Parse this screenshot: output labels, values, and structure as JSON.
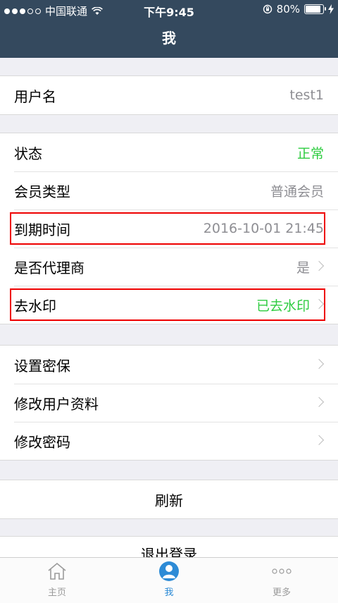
{
  "status_bar": {
    "carrier": "中国联通",
    "time": "下午9:45",
    "battery": "80%"
  },
  "nav": {
    "title": "我"
  },
  "account": {
    "username_label": "用户名",
    "username_value": "test1"
  },
  "info": {
    "status_label": "状态",
    "status_value": "正常",
    "member_type_label": "会员类型",
    "member_type_value": "普通会员",
    "expiry_label": "到期时间",
    "expiry_value": "2016-10-01 21:45",
    "agent_label": "是否代理商",
    "agent_value": "是",
    "watermark_label": "去水印",
    "watermark_value": "已去水印"
  },
  "settings": {
    "security_label": "设置密保",
    "edit_profile_label": "修改用户资料",
    "change_password_label": "修改密码"
  },
  "actions": {
    "refresh_label": "刷新",
    "logout_label": "退出登录"
  },
  "tabbar": {
    "home_label": "主页",
    "me_label": "我",
    "more_label": "更多"
  },
  "colors": {
    "navbar": "#34495e",
    "green": "#2ecc40",
    "active_tab": "#2d8bd6",
    "highlight": "#e00000"
  }
}
